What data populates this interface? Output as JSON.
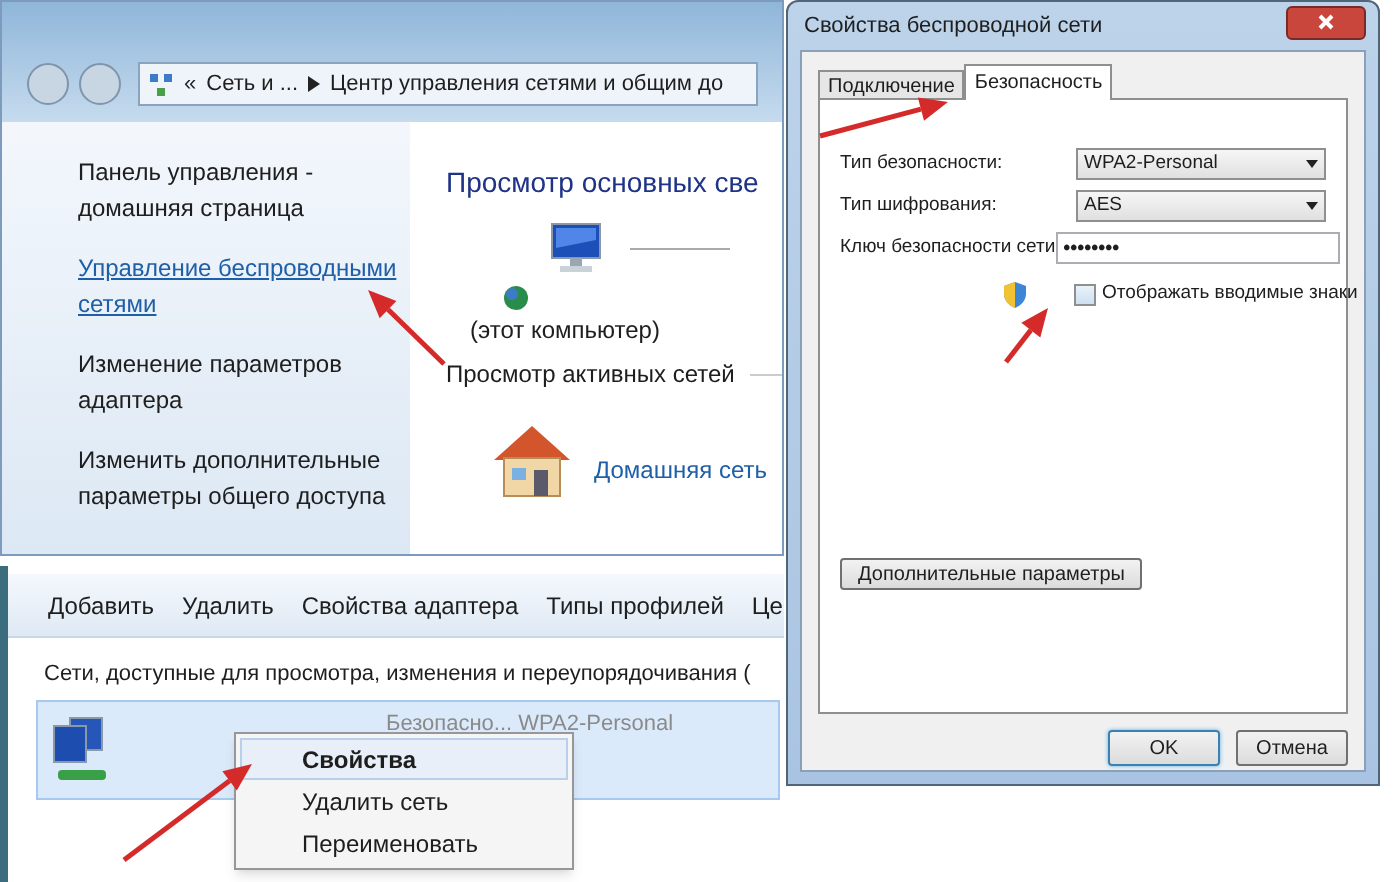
{
  "explorer": {
    "breadcrumb": {
      "overflow": "«",
      "parent": "Сеть и ...",
      "current": "Центр управления сетями и общим до"
    },
    "sidebar": {
      "items": [
        {
          "label": "Панель управления - домашняя страница",
          "hovered": false
        },
        {
          "label": "Управление беспроводными сетями",
          "hovered": true
        },
        {
          "label": "Изменение параметров адаптера",
          "hovered": false
        },
        {
          "label": "Изменить дополнительные параметры общего доступа",
          "hovered": false
        }
      ]
    },
    "heading": "Просмотр основных све",
    "this_computer": "(этот компьютер)",
    "active_networks_heading": "Просмотр активных сетей",
    "network_link": "Домашняя сеть"
  },
  "wireless": {
    "toolbar": [
      "Добавить",
      "Удалить",
      "Свойства адаптера",
      "Типы профилей",
      "Це"
    ],
    "caption": "Сети, доступные для просмотра, изменения и переупорядочивания (",
    "network": {
      "security": "Безопасно... WPA2-Personal",
      "selected": true
    },
    "context_menu": [
      {
        "label": "Свойства",
        "selected": true
      },
      {
        "label": "Удалить сеть",
        "selected": false
      },
      {
        "label": "Переименовать",
        "selected": false
      }
    ]
  },
  "dialog": {
    "title": "Свойства беспроводной сети",
    "tabs": [
      {
        "label": "Подключение",
        "selected": false
      },
      {
        "label": "Безопасность",
        "selected": true
      }
    ],
    "fields": [
      {
        "kind": "select",
        "label": "Тип безопасности:",
        "value": "WPA2-Personal"
      },
      {
        "kind": "select",
        "label": "Тип шифрования:",
        "value": "AES"
      },
      {
        "kind": "password",
        "label": "Ключ безопасности сети",
        "value": "••••••••"
      }
    ],
    "show_characters": {
      "label": "Отображать вводимые знаки",
      "checked": false
    },
    "advanced_button": "Дополнительные параметры",
    "buttons": [
      {
        "label": "OK",
        "default": true
      },
      {
        "label": "Отмена",
        "default": false
      }
    ]
  }
}
